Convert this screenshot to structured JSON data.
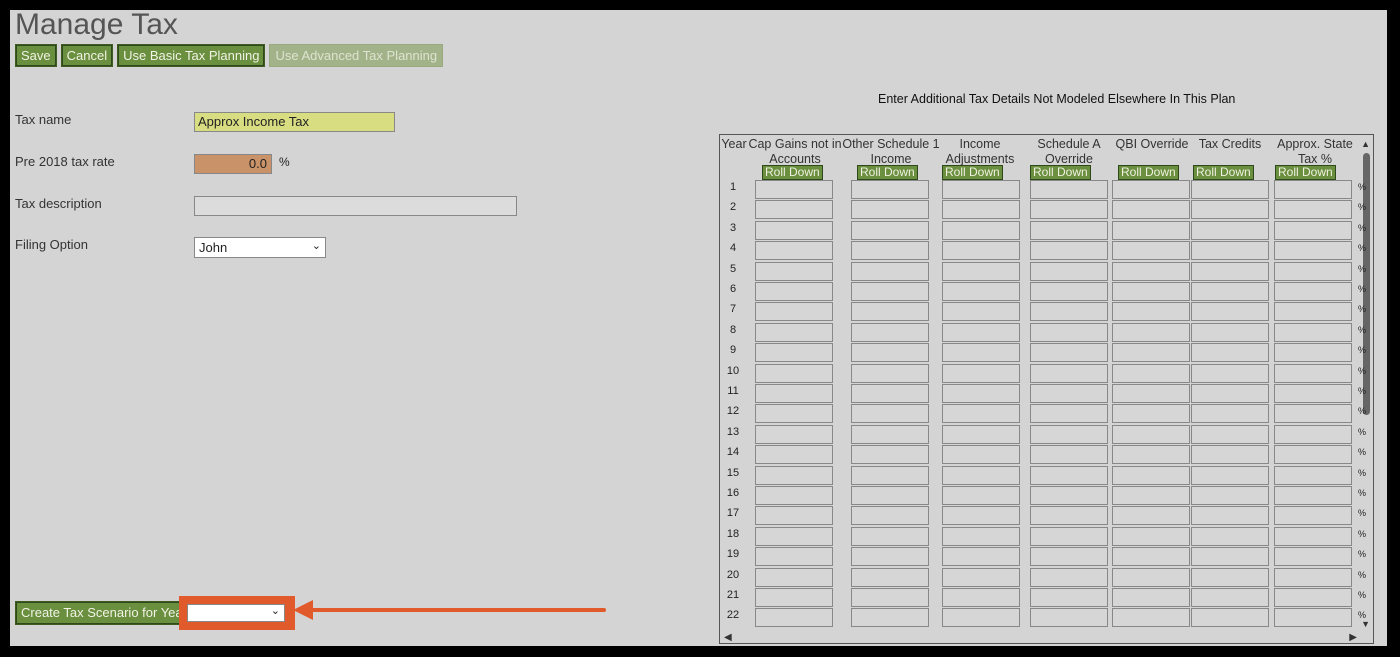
{
  "page": {
    "title": "Manage Tax"
  },
  "toolbar": {
    "save": "Save",
    "cancel": "Cancel",
    "basic": "Use Basic Tax Planning",
    "advanced": "Use Advanced Tax Planning"
  },
  "form": {
    "tax_name_label": "Tax name",
    "tax_name_value": "Approx Income Tax",
    "rate_label": "Pre 2018 tax rate",
    "rate_value": "0.0",
    "rate_suffix": "%",
    "desc_label": "Tax description",
    "desc_value": "",
    "filing_label": "Filing Option",
    "filing_value": "John"
  },
  "scenario": {
    "button": "Create Tax Scenario for Year",
    "selected": ""
  },
  "grid": {
    "title": "Enter Additional Tax Details Not Modeled Elsewhere In This Plan",
    "year_header": "Year",
    "roll_label": "Roll Down",
    "columns": [
      {
        "label": "Cap Gains not in Accounts"
      },
      {
        "label": "Other Schedule 1 Income"
      },
      {
        "label": "Income Adjustments"
      },
      {
        "label": "Schedule A Override"
      },
      {
        "label": "QBI Override"
      },
      {
        "label": "Tax Credits"
      },
      {
        "label": "Approx. State Tax %"
      }
    ],
    "rows": [
      "1",
      "2",
      "3",
      "4",
      "5",
      "6",
      "7",
      "8",
      "9",
      "10",
      "11",
      "12",
      "13",
      "14",
      "15",
      "16",
      "17",
      "18",
      "19",
      "20",
      "21",
      "22"
    ],
    "pct_symbol": "%"
  },
  "colors": {
    "button_green": "#6a8f3e",
    "highlight": "#e05a2b",
    "tax_name_bg": "#d8dd82",
    "rate_bg": "#c99268"
  }
}
